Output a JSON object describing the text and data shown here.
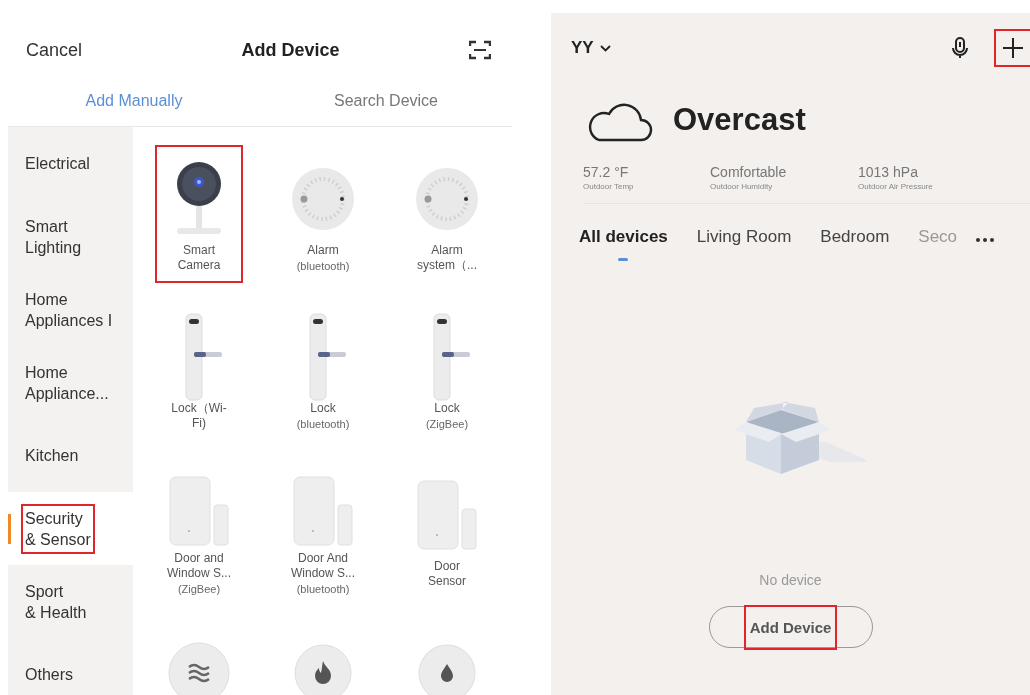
{
  "add_device_screen": {
    "cancel": "Cancel",
    "title": "Add Device",
    "tabs": [
      {
        "label": "Add Manually",
        "selected": true
      },
      {
        "label": "Search Device",
        "selected": false
      }
    ],
    "categories": [
      {
        "label": "Electrical",
        "selected": false,
        "highlighted": false
      },
      {
        "label": "Smart\nLighting",
        "selected": false,
        "highlighted": false
      },
      {
        "label": "Home\nAppliances I",
        "selected": false,
        "highlighted": false
      },
      {
        "label": "Home\nAppliance...",
        "selected": false,
        "highlighted": false
      },
      {
        "label": "Kitchen",
        "selected": false,
        "highlighted": false
      },
      {
        "label": "Security\n& Sensor",
        "selected": true,
        "highlighted": true
      },
      {
        "label": "Sport\n& Health",
        "selected": false,
        "highlighted": false
      },
      {
        "label": "Others",
        "selected": false,
        "highlighted": false
      }
    ],
    "devices": [
      {
        "kind": "camera",
        "name": "Smart\nCamera",
        "highlighted": true
      },
      {
        "kind": "alarm",
        "name": "Alarm",
        "sub": "(bluetooth)",
        "highlighted": false
      },
      {
        "kind": "alarm",
        "name": "Alarm\nsystem（...",
        "highlighted": false
      },
      {
        "kind": "lock",
        "name": "Lock（Wi-\nFi)",
        "highlighted": false
      },
      {
        "kind": "lock",
        "name": "Lock",
        "sub": "(bluetooth)",
        "highlighted": false
      },
      {
        "kind": "lock",
        "name": "Lock",
        "sub": "(ZigBee)",
        "highlighted": false
      },
      {
        "kind": "contact",
        "name": "Door and\nWindow S...",
        "sub": "(ZigBee)",
        "highlighted": false
      },
      {
        "kind": "contact",
        "name": "Door And\nWindow S...",
        "sub": "(bluetooth)",
        "highlighted": false
      },
      {
        "kind": "contact",
        "name": "Door\nSensor",
        "highlighted": false
      },
      {
        "kind": "gas",
        "highlighted": false
      },
      {
        "kind": "fire",
        "highlighted": false
      },
      {
        "kind": "water",
        "highlighted": false
      }
    ]
  },
  "home_screen": {
    "home_name": "YY",
    "add_highlighted": true,
    "weather": "Overcast",
    "stats": [
      {
        "value": "57.2 °F",
        "caption": "Outdoor Temp"
      },
      {
        "value": "Comfortable",
        "caption": "Outdoor Humidity"
      },
      {
        "value": "1013 hPa",
        "caption": "Outdoor Air Pressure"
      }
    ],
    "rooms": [
      {
        "label": "All devices",
        "selected": true
      },
      {
        "label": "Living Room",
        "selected": false
      },
      {
        "label": "Bedroom",
        "selected": false
      },
      {
        "label": "Seco",
        "selected": false
      }
    ],
    "empty_text": "No device",
    "add_button": {
      "label": "Add Device",
      "highlighted": true
    }
  }
}
